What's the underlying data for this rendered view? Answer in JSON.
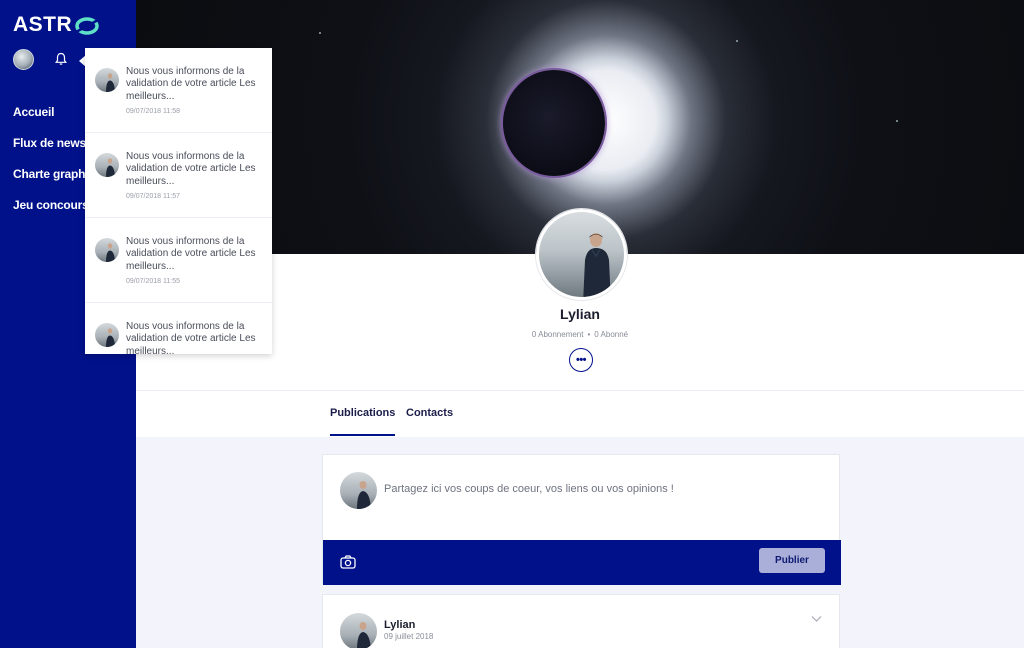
{
  "sidebar": {
    "logo": "ASTR",
    "nav": [
      {
        "label": "Accueil"
      },
      {
        "label": "Flux de news"
      },
      {
        "label": "Charte graphique"
      },
      {
        "label": "Jeu concours"
      }
    ]
  },
  "notifications": [
    {
      "text": "Nous vous informons de la validation de votre article Les meilleurs...",
      "time": "09/07/2018 11:58"
    },
    {
      "text": "Nous vous informons de la validation de votre article Les meilleurs...",
      "time": "09/07/2018 11:57"
    },
    {
      "text": "Nous vous informons de la validation de votre article Les meilleurs...",
      "time": "09/07/2018 11:55"
    },
    {
      "text": "Nous vous informons de la validation de votre article Les meilleurs...",
      "time": ""
    }
  ],
  "profile": {
    "name": "Lylian",
    "subscriptions": "0 Abonnement",
    "subscribers": "0 Abonné",
    "more": "•••"
  },
  "tabs": [
    {
      "label": "Publications",
      "active": true
    },
    {
      "label": "Contacts",
      "active": false
    }
  ],
  "composer": {
    "placeholder": "Partagez ici vos coups de coeur, vos liens ou vos opinions !",
    "publish_label": "Publier"
  },
  "post": {
    "author": "Lylian",
    "date": "09 juillet 2018"
  },
  "colors": {
    "brand": "#00118a",
    "accent": "#5fe0c6"
  }
}
